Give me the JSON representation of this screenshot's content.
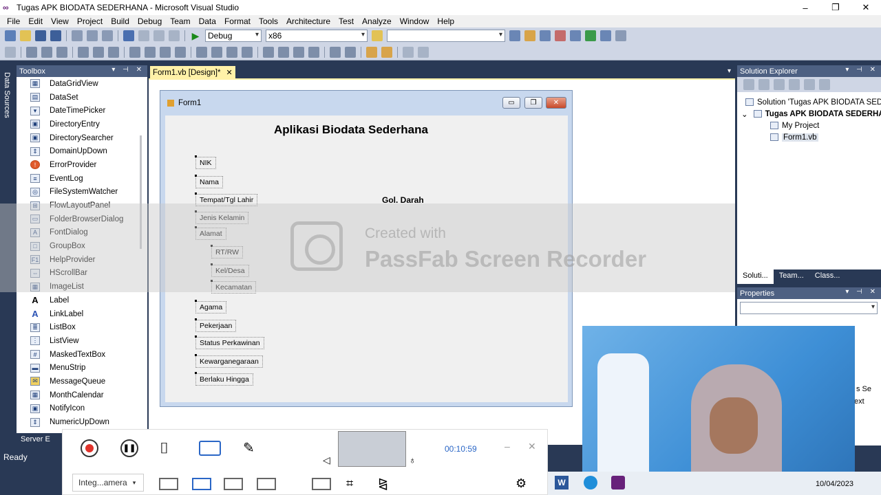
{
  "window": {
    "title": "Tugas APK BIODATA SEDERHANA - Microsoft Visual Studio",
    "controls": [
      "–",
      "❐",
      "✕"
    ]
  },
  "menu": [
    "File",
    "Edit",
    "View",
    "Project",
    "Build",
    "Debug",
    "Team",
    "Data",
    "Format",
    "Tools",
    "Architecture",
    "Test",
    "Analyze",
    "Window",
    "Help"
  ],
  "toolbar": {
    "config": "Debug",
    "platform": "x86",
    "search": ""
  },
  "side_strip": {
    "label": "Data Sources"
  },
  "toolbox": {
    "title": "Toolbox",
    "items": [
      "DataGridView",
      "DataSet",
      "DateTimePicker",
      "DirectoryEntry",
      "DirectorySearcher",
      "DomainUpDown",
      "ErrorProvider",
      "EventLog",
      "FileSystemWatcher",
      "FlowLayoutPanel",
      "FolderBrowserDialog",
      "FontDialog",
      "GroupBox",
      "HelpProvider",
      "HScrollBar",
      "ImageList",
      "Label",
      "LinkLabel",
      "ListBox",
      "ListView",
      "MaskedTextBox",
      "MenuStrip",
      "MessageQueue",
      "MonthCalendar",
      "NotifyIcon",
      "NumericUpDown"
    ]
  },
  "document": {
    "tab": "Form1.vb [Design]*"
  },
  "form": {
    "title": "Form1",
    "heading": "Aplikasi Biodata Sederhana",
    "labels": [
      "NIK",
      "Nama",
      "Tempat/Tgl Lahir",
      "Jenis Kelamin",
      "Alamat",
      "RT/RW",
      "Kel/Desa",
      "Kecamatan",
      "Agama",
      "Pekerjaan",
      "Status Perkawinan",
      "Kewarganegaraan",
      "Berlaku Hingga"
    ],
    "gol_darah": "Gol. Darah"
  },
  "watermark": {
    "line1": "Created with",
    "line2": "PassFab Screen Recorder"
  },
  "solution_explorer": {
    "title": "Solution Explorer",
    "tree": [
      "Solution 'Tugas APK BIODATA SEDE",
      "Tugas APK BIODATA SEDERHA",
      "My Project",
      "Form1.vb"
    ],
    "tabs": [
      "Soluti...",
      "Team...",
      "Class..."
    ]
  },
  "properties": {
    "title": "Properties",
    "partial_text": [
      "s Se",
      "ext"
    ]
  },
  "server_explorer": "Server E",
  "status": "Ready",
  "recorder": {
    "time": "00:10:59",
    "camera": "Integ...amera"
  },
  "taskbar": {
    "date": "10/04/2023"
  }
}
